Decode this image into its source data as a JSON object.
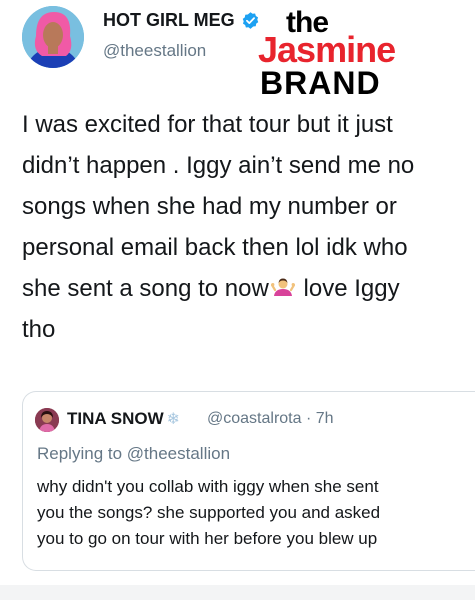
{
  "tweet": {
    "display_name": "HOT GIRL MEG",
    "handle": "@theestallion",
    "verified_icon": "verified-badge-icon",
    "avatar_icon": "profile-avatar",
    "text_part1": "I was excited for that tour but it just\ndidn’t happen . Iggy ain’t send me no\nsongs when she had my number or\npersonal email back then lol idk who\nshe sent a song to now",
    "emoji_icon": "person-shrugging-emoji",
    "text_part2": " love Iggy\ntho"
  },
  "watermark": {
    "line1": "the",
    "line2": "Jasmine",
    "line3": "BRAND",
    "accent_color": "#e8242d"
  },
  "quoted_tweet": {
    "display_name": "TINA SNOW",
    "name_icon": "❄",
    "handle_time": "@coastalrota · 7h",
    "replying_to": "Replying to @theestallion",
    "text": "why didn't you collab with iggy when she sent\nyou the songs? she supported you and asked\nyou to go on tour with her before you blew up"
  },
  "colors": {
    "text": "#14171a",
    "secondary": "#657786",
    "verified": "#1da1f2",
    "border": "#d8dee3"
  }
}
